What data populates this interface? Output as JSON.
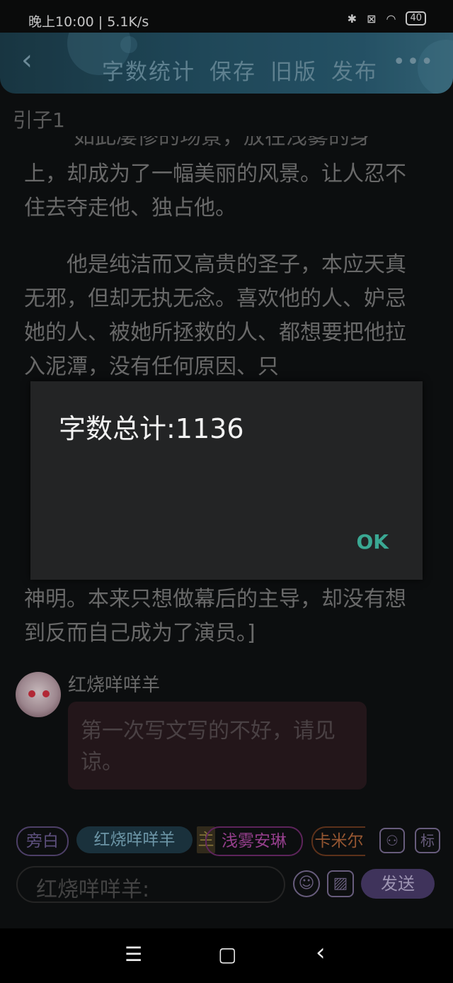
{
  "status": {
    "time": "晚上10:00 | 5.1K/s",
    "battery": "40"
  },
  "header": {
    "actions": [
      "字数统计",
      "保存",
      "旧版",
      "发布"
    ],
    "more": "•••"
  },
  "chapter": "引子1",
  "story": {
    "clipped_line": "如此凄惨的场景，放在浅雾的身",
    "para1": "上，却成为了一幅美丽的风景。让人忍不住去夺走他、独占他。",
    "para2": "　　他是纯洁而又高贵的圣子，本应天真无邪，但却无执无念。喜欢他的人、妒忌她的人、被她所拯救的人、都想要把他拉入泥潭，没有任何原因、只",
    "para3": "神明。本来只想做幕后的主导，却没有想到反而自己成为了演员。]"
  },
  "dialog": {
    "title": "字数总计:1136",
    "ok": "OK"
  },
  "message": {
    "username": "红烧咩咩羊",
    "text": "第一次写文写的不好，请见谅。"
  },
  "chips": {
    "narrator": "旁白",
    "char1": "红烧咩咩羊",
    "tag": "主",
    "char2": "浅雾安琳",
    "char3": "卡米尔"
  },
  "toolbar": {
    "label_icon": "标",
    "input_placeholder": "红烧咩咩羊:",
    "send": "发送"
  },
  "nav": {
    "menu": "☰",
    "home": "▢",
    "back": "‹"
  }
}
